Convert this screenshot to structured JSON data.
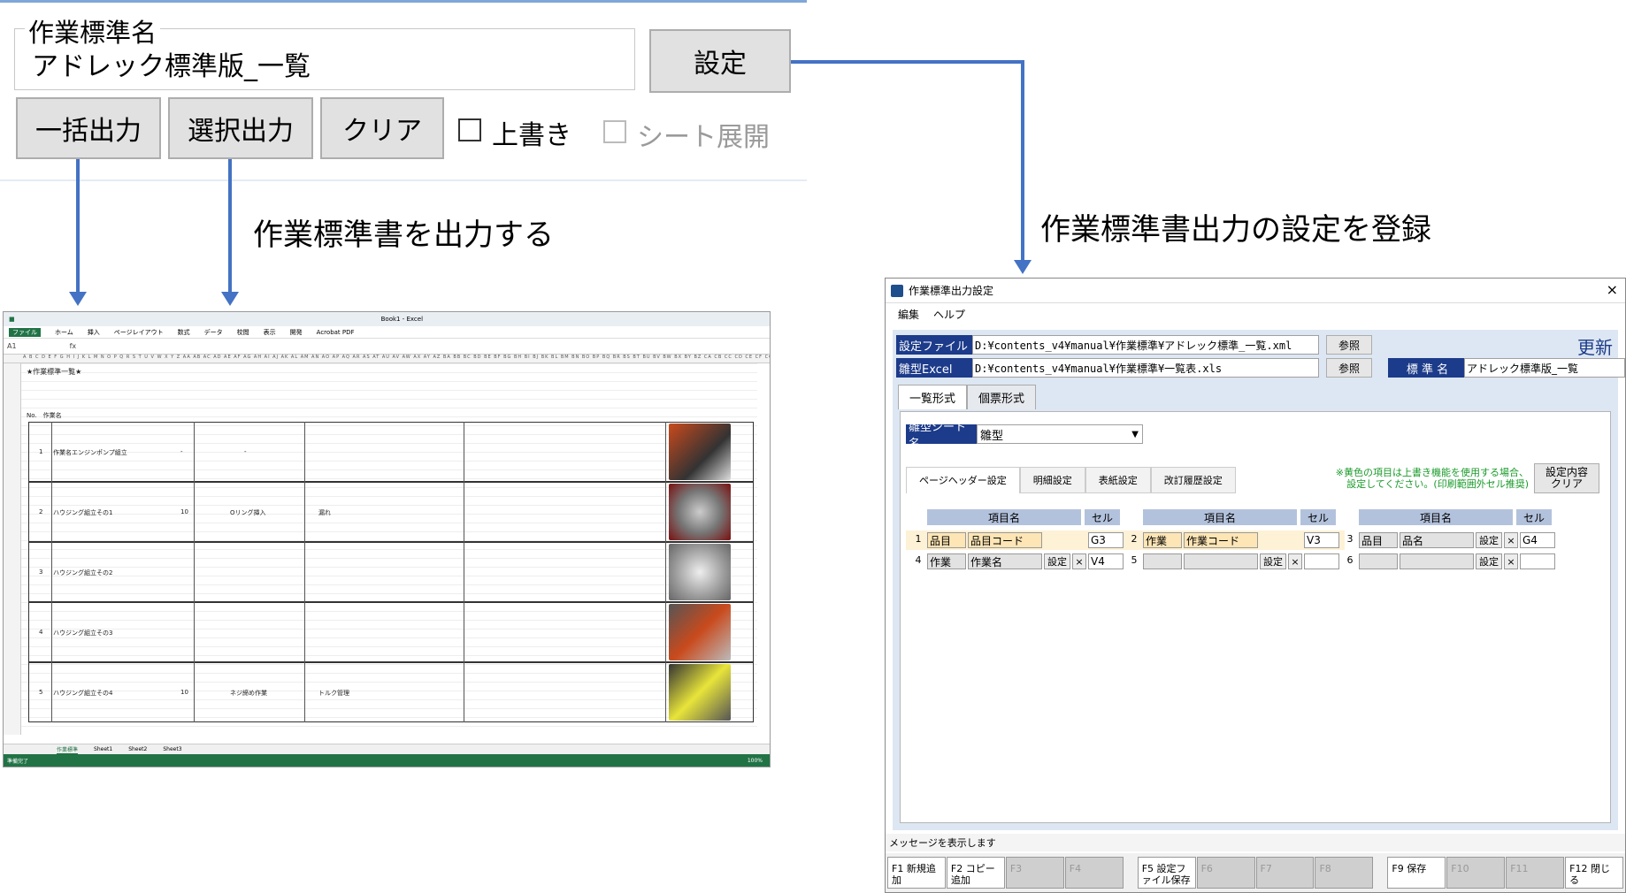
{
  "top_panel": {
    "field_legend": "作業標準名",
    "field_value": "アドレック標準版_一覧",
    "set_button": "設定",
    "bulk_output_button": "一括出力",
    "select_output_button": "選択出力",
    "clear_button": "クリア",
    "overwrite_label": "上書き",
    "sheet_expand_label": "シート展開"
  },
  "captions": {
    "output_caption": "作業標準書を出力する",
    "register_caption": "作業標準書出力の設定を登録"
  },
  "excel": {
    "title": "Book1 - Excel",
    "ribbon_tabs": [
      "ファイル",
      "ホーム",
      "挿入",
      "ページレイアウト",
      "数式",
      "データ",
      "校閲",
      "表示",
      "開発",
      "Acrobat PDF"
    ],
    "cell_ref": "A1",
    "sheet_tabs": [
      "作業標準",
      "Sheet1",
      "Sheet2",
      "Sheet3"
    ],
    "status": "準備完了",
    "zoom": "100%",
    "doc_title": "★作業標準一覧★",
    "rows": [
      {
        "no": "1",
        "name": "作業名エンジンポンプ組立",
        "qty": "-",
        "part": "-",
        "note": ""
      },
      {
        "no": "2",
        "name": "ハウジング組立その1",
        "qty": "10",
        "part": "Oリング挿入",
        "note": "漏れ"
      },
      {
        "no": "3",
        "name": "ハウジング組立その2",
        "qty": "",
        "part": "",
        "note": ""
      },
      {
        "no": "4",
        "name": "ハウジング組立その3",
        "qty": "",
        "part": "",
        "note": ""
      },
      {
        "no": "5",
        "name": "ハウジング組立その4",
        "qty": "10",
        "part": "ネジ締め作業",
        "note": "トルク管理"
      }
    ]
  },
  "dialog": {
    "title": "作業標準出力設定",
    "close": "×",
    "menu": [
      "編集",
      "ヘルプ"
    ],
    "settings_file_label": "設定ファイル",
    "settings_file_path": "D:¥contents_v4¥manual¥作業標準¥アドレック標準_一覧.xml",
    "template_excel_label": "雛型Excel",
    "template_excel_path": "D:¥contents_v4¥manual¥作業標準¥一覧表.xls",
    "browse": "参照",
    "update": "更新",
    "std_name_label": "標 準 名",
    "std_name_value": "アドレック標準版_一覧",
    "tabs": [
      "一覧形式",
      "個票形式"
    ],
    "template_sheet_label": "雛型シート名",
    "template_sheet_value": "雛型",
    "subtabs": [
      "ページヘッダー設定",
      "明細設定",
      "表紙設定",
      "改訂履歴設定"
    ],
    "note_line1": "※黄色の項目は上書き機能を使用する場合、",
    "note_line2": "設定してください。(印刷範囲外セル推奨)",
    "clear_settings_1": "設定内容",
    "clear_settings_2": "クリア",
    "col_item": "項目名",
    "col_cell": "セル",
    "set_small": "設定",
    "x_small": "×",
    "items": [
      {
        "n": "1",
        "a": "品目",
        "b": "品目コード",
        "cell": "G3"
      },
      {
        "n": "2",
        "a": "作業",
        "b": "作業コード",
        "cell": "V3"
      },
      {
        "n": "3",
        "a": "品目",
        "b": "品名",
        "cell": "G4"
      },
      {
        "n": "4",
        "a": "作業",
        "b": "作業名",
        "cell": "V4"
      },
      {
        "n": "5",
        "a": "",
        "b": "",
        "cell": ""
      },
      {
        "n": "6",
        "a": "",
        "b": "",
        "cell": ""
      }
    ],
    "message": "メッセージを表示します",
    "fkeys": [
      "F1 新規追加",
      "F2 コピー追加",
      "F3",
      "F4",
      "F5 設定ファイル保存",
      "F6",
      "F7",
      "F8",
      "F9 保存",
      "F10",
      "F11",
      "F12 閉じる"
    ]
  },
  "colors": {
    "accent_blue": "#4472c4",
    "label_navy": "#1c3b8a",
    "excel_green": "#217346",
    "note_green": "#1a9a2a",
    "highlight_yellow": "#fde5b5"
  }
}
